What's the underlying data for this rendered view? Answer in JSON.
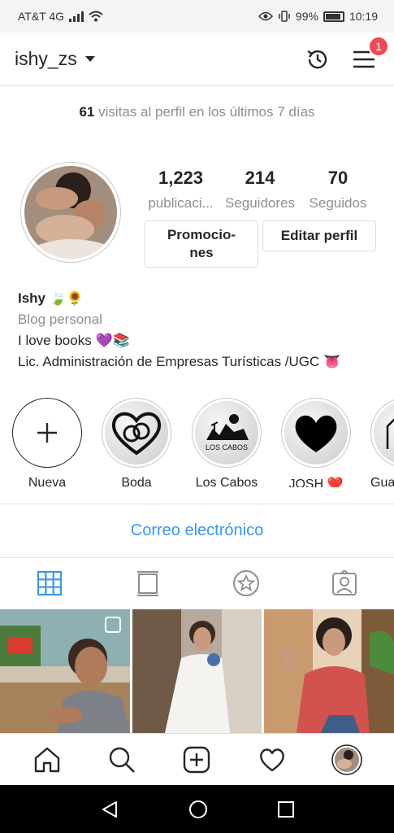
{
  "status_bar": {
    "carrier": "AT&T 4G",
    "battery": "99%",
    "time": "10:19"
  },
  "header": {
    "username": "ishy_zs",
    "notification_count": "1"
  },
  "profile": {
    "visits_count": "61",
    "visits_text": "visitas al perfil en los últimos 7 días",
    "stats": [
      {
        "value": "1,223",
        "label": "publicaci..."
      },
      {
        "value": "214",
        "label": "Seguidores"
      },
      {
        "value": "70",
        "label": "Seguidos"
      }
    ],
    "promo_label": "Promocio-\nnes",
    "edit_label": "Editar perfil"
  },
  "bio": {
    "name": "Ishy 🍃🌻",
    "category": "Blog personal",
    "line1": "I love books 💜📚",
    "line2": "Lic. Administración de Empresas Turísticas /UGC 👅"
  },
  "highlights": [
    {
      "label": "Nueva"
    },
    {
      "label": "Boda"
    },
    {
      "label": "Los Cabos",
      "badge_text": "LOS CABOS"
    },
    {
      "label": "JOSH ❤️"
    },
    {
      "label": "Gua"
    }
  ],
  "email_label": "Correo electrónico",
  "tabs": [
    "grid-icon",
    "igtv-icon",
    "saved-star-icon",
    "tagged-icon"
  ],
  "bottom_nav": [
    "home-icon",
    "search-icon",
    "new-post-icon",
    "heart-icon",
    "profile-avatar"
  ],
  "colors": {
    "link_blue": "#3897f0",
    "badge_red": "#ed4956",
    "muted_text": "#8e8e8e"
  }
}
